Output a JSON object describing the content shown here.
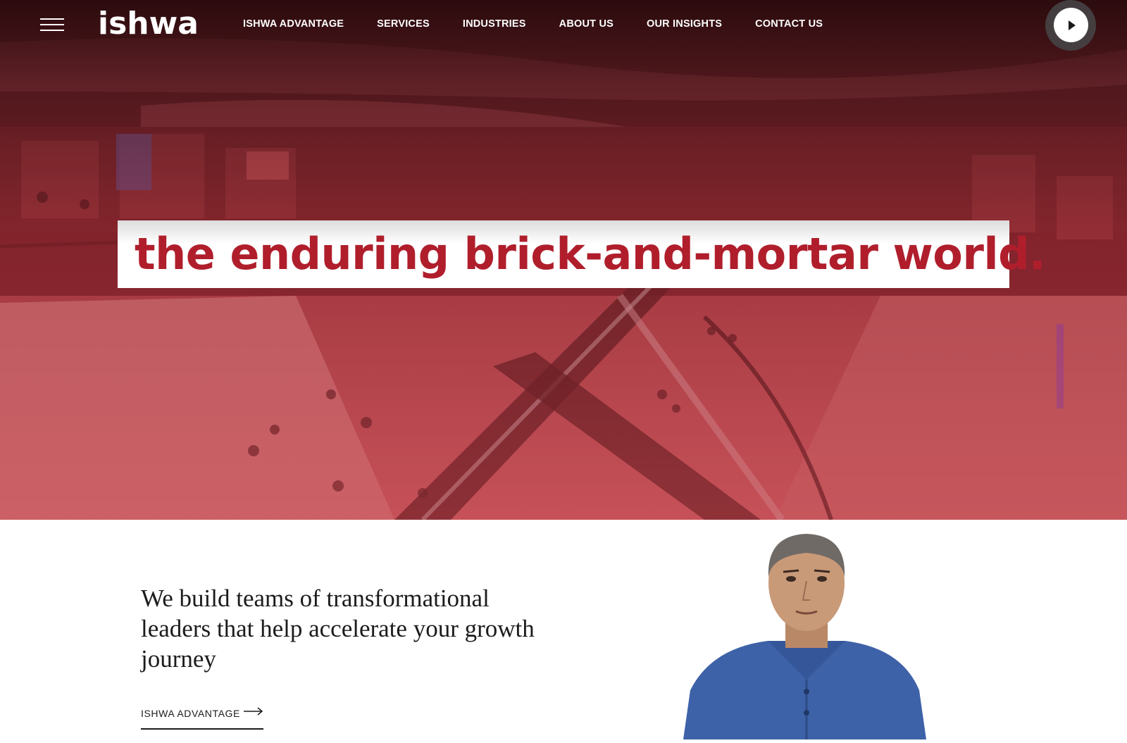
{
  "nav": {
    "menu_icon": "hamburger-icon",
    "logo": "ishwa",
    "links": [
      {
        "label": "ISHWA ADVANTAGE"
      },
      {
        "label": "SERVICES"
      },
      {
        "label": "INDUSTRIES"
      },
      {
        "label": "ABOUT US"
      },
      {
        "label": "OUR INSIGHTS"
      },
      {
        "label": "CONTACT US"
      }
    ],
    "play_icon": "play-icon"
  },
  "hero": {
    "headline": "the enduring brick-and-mortar world.",
    "image_subject": "shopping mall interior with escalators",
    "tint_color": "#b01e2c"
  },
  "intro": {
    "tagline": "We build teams of transformational leaders that help accelerate your growth journey",
    "cta_label": "ISHWA ADVANTAGE",
    "cta_icon": "arrow-right-icon"
  },
  "colors": {
    "accent": "#b01e2c",
    "text_dark": "#1c1c1c",
    "nav_text": "#ffffff"
  }
}
